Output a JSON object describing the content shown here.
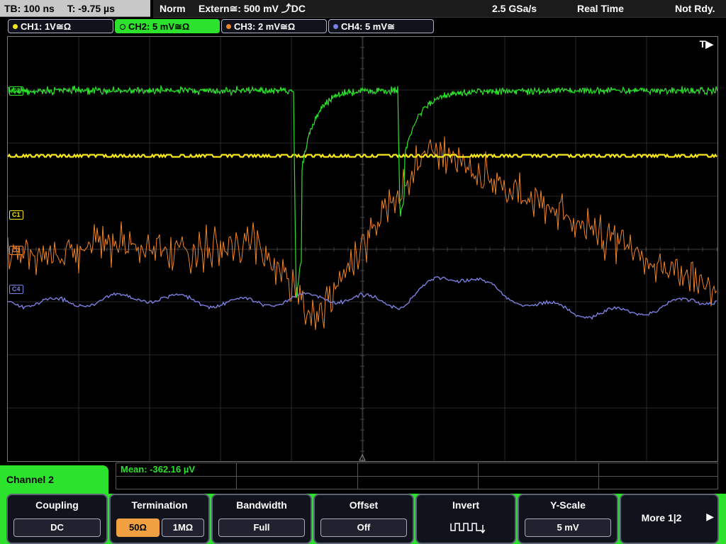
{
  "status_bar": {
    "timebase": "TB: 100 ns",
    "trigger_time": "T: -9.75 µs",
    "trigger_mode": "Norm",
    "trigger_source": "Extern≅: 500 mV ⤴DC",
    "sample_rate": "2.5 GSa/s",
    "acq_mode": "Real Time",
    "state": "Not Rdy."
  },
  "channels": [
    {
      "label": "CH1: 1V≅Ω",
      "color": "#f5e61e",
      "active": false
    },
    {
      "label": "CH2: 5 mV≅Ω",
      "color": "#2ce22c",
      "active": true
    },
    {
      "label": "CH3: 2 mV≅Ω",
      "color": "#f0842a",
      "active": false
    },
    {
      "label": "CH4: 5 mV≅",
      "color": "#7b7fe0",
      "active": false
    }
  ],
  "screen": {
    "trigger_marker": "T▶",
    "markers": {
      "c2": "C2",
      "c1": "C1",
      "c3": "C3",
      "c4": "C4"
    }
  },
  "panel": {
    "title": "Channel 2",
    "mean": "Mean: -362.16 µV"
  },
  "softkeys": {
    "coupling": {
      "title": "Coupling",
      "value": "DC"
    },
    "termination": {
      "title": "Termination",
      "opt1": "50Ω",
      "opt2": "1MΩ",
      "selected": "50Ω"
    },
    "bandwidth": {
      "title": "Bandwidth",
      "value": "Full"
    },
    "offset": {
      "title": "Offset",
      "value": "Off"
    },
    "invert": {
      "title": "Invert",
      "icon": "invert-square-wave-icon"
    },
    "yscale": {
      "title": "Y-Scale",
      "value": "5 mV"
    },
    "more": {
      "label": "More 1|2"
    }
  }
}
